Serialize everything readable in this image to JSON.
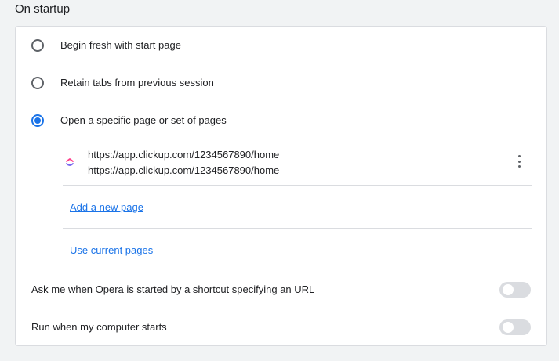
{
  "section": {
    "title": "On startup"
  },
  "startup_options": [
    {
      "label": "Begin fresh with start page",
      "selected": false
    },
    {
      "label": "Retain tabs from previous session",
      "selected": false
    },
    {
      "label": "Open a specific page or set of pages",
      "selected": true
    }
  ],
  "pages": [
    {
      "icon": "clickup-icon",
      "title": "https://app.clickup.com/1234567890/home",
      "url": "https://app.clickup.com/1234567890/home"
    }
  ],
  "links": {
    "add_new_page": "Add a new page",
    "use_current_pages": "Use current pages"
  },
  "toggles": [
    {
      "label": "Ask me when Opera is started by a shortcut specifying an URL",
      "on": false
    },
    {
      "label": "Run when my computer starts",
      "on": false
    }
  ],
  "colors": {
    "accent": "#1a73e8",
    "toggle_off_track": "#dadce0",
    "divider": "#dadce0"
  }
}
